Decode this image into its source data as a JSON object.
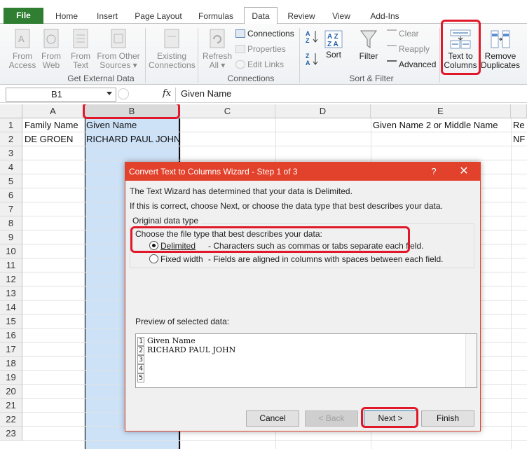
{
  "ribbon_tabs": [
    "File",
    "Home",
    "Insert",
    "Page Layout",
    "Formulas",
    "Data",
    "Review",
    "View",
    "Add-Ins"
  ],
  "active_tab": "Data",
  "get_external_data": {
    "label": "Get External Data",
    "from_access": [
      "From",
      "Access"
    ],
    "from_web": [
      "From",
      "Web"
    ],
    "from_text": [
      "From",
      "Text"
    ],
    "from_other": [
      "From Other",
      "Sources ▾"
    ],
    "existing": [
      "Existing",
      "Connections"
    ]
  },
  "connections": {
    "label": "Connections",
    "refresh": [
      "Refresh",
      "All ▾"
    ],
    "connections": "Connections",
    "properties": "Properties",
    "edit_links": "Edit Links"
  },
  "sort_filter": {
    "label": "Sort & Filter",
    "sort": "Sort",
    "filter": "Filter",
    "clear": "Clear",
    "reapply": "Reapply",
    "advanced": "Advanced"
  },
  "data_tools": {
    "text_to_columns": [
      "Text to",
      "Columns"
    ],
    "remove_duplicates": [
      "Remove",
      "Duplicates"
    ]
  },
  "formula_bar": {
    "name_box": "B1",
    "fx": "fx",
    "content": "Given Name"
  },
  "grid": {
    "columns": [
      "A",
      "B",
      "C",
      "D",
      "E"
    ],
    "rows": [
      "1",
      "2",
      "3",
      "4",
      "5",
      "6",
      "7",
      "8",
      "9",
      "10",
      "11",
      "12",
      "13",
      "14",
      "15",
      "16",
      "17",
      "18",
      "19",
      "20",
      "21",
      "22",
      "23"
    ],
    "cells": {
      "A1": "Family Name",
      "B1": "Given Name",
      "E1": "Given Name 2 or Middle Name",
      "F1": "Re",
      "A2": "DE GROEN",
      "B2": "RICHARD PAUL JOHN",
      "F2": "NF"
    }
  },
  "dialog": {
    "title": "Convert Text to Columns Wizard - Step 1 of 3",
    "help": "?",
    "close": "✕",
    "line1": "The Text Wizard has determined that your data is Delimited.",
    "line2": "If this is correct, choose Next, or choose the data type that best describes your data.",
    "group_label": "Original data type",
    "choose_label": "Choose the file type that best describes your data:",
    "delimited_label": "Delimited",
    "delimited_desc": "- Characters such as commas or tabs separate each field.",
    "fixed_label": "Fixed width",
    "fixed_desc": "- Fields are aligned in columns with spaces between each field.",
    "selected_option": "delimited",
    "preview_label": "Preview of selected data:",
    "preview_lines": [
      "Given Name",
      "RICHARD PAUL JOHN",
      "",
      "",
      ""
    ],
    "preview_nums": [
      "1",
      "2",
      "3",
      "4",
      "5"
    ],
    "buttons": {
      "cancel": "Cancel",
      "back": "< Back",
      "next": "Next >",
      "finish": "Finish"
    }
  },
  "colors": {
    "excel_green": "#2f7e32",
    "dialog_red": "#e2412b",
    "selection_blue": "#cde1f7",
    "highlight_red": "#e0182a"
  }
}
